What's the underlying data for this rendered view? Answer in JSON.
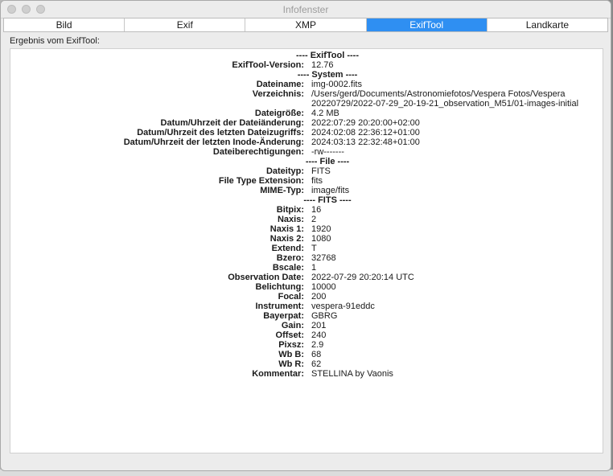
{
  "window": {
    "title": "Infofenster"
  },
  "tabs": [
    {
      "label": "Bild",
      "active": false
    },
    {
      "label": "Exif",
      "active": false
    },
    {
      "label": "XMP",
      "active": false
    },
    {
      "label": "ExifTool",
      "active": true
    },
    {
      "label": "Landkarte",
      "active": false
    }
  ],
  "result_label": "Ergebnis vom ExifTool:",
  "colors": {
    "accent": "#2f8ff2"
  },
  "rows": [
    {
      "section": "---- ExifTool ----"
    },
    {
      "key": "ExifTool-Version:",
      "value": "12.76"
    },
    {
      "section": "---- System ----"
    },
    {
      "key": "Dateiname:",
      "value": "img-0002.fits"
    },
    {
      "key": "Verzeichnis:",
      "value": "/Users/gerd/Documents/Astronomiefotos/Vespera Fotos/Vespera 20220729/2022-07-29_20-19-21_observation_M51/01-images-initial",
      "tall": true
    },
    {
      "key": "Dateigröße:",
      "value": "4.2 MB"
    },
    {
      "key": "Datum/Uhrzeit der Dateiänderung:",
      "value": "2022:07:29 20:20:00+02:00"
    },
    {
      "key": "Datum/Uhrzeit des letzten Dateizugriffs:",
      "value": "2024:02:08 22:36:12+01:00"
    },
    {
      "key": "Datum/Uhrzeit der letzten Inode-Änderung:",
      "value": "2024:03:13 22:32:48+01:00"
    },
    {
      "key": "Dateiberechtigungen:",
      "value": "-rw-------"
    },
    {
      "section": "---- File ----"
    },
    {
      "key": "Dateityp:",
      "value": "FITS"
    },
    {
      "key": "File Type Extension:",
      "value": "fits"
    },
    {
      "key": "MIME-Typ:",
      "value": "image/fits"
    },
    {
      "section": "---- FITS ----"
    },
    {
      "key": "Bitpix:",
      "value": "16"
    },
    {
      "key": "Naxis:",
      "value": "2"
    },
    {
      "key": "Naxis 1:",
      "value": "1920"
    },
    {
      "key": "Naxis 2:",
      "value": "1080"
    },
    {
      "key": "Extend:",
      "value": "T"
    },
    {
      "key": "Bzero:",
      "value": "32768"
    },
    {
      "key": "Bscale:",
      "value": "1"
    },
    {
      "key": "Observation Date:",
      "value": "2022-07-29 20:20:14 UTC"
    },
    {
      "key": "Belichtung:",
      "value": "10000"
    },
    {
      "key": "Focal:",
      "value": "200"
    },
    {
      "key": "Instrument:",
      "value": "vespera-91eddc"
    },
    {
      "key": "Bayerpat:",
      "value": "GBRG"
    },
    {
      "key": "Gain:",
      "value": "201"
    },
    {
      "key": "Offset:",
      "value": "240"
    },
    {
      "key": "Pixsz:",
      "value": "2.9"
    },
    {
      "key": "Wb B:",
      "value": "68"
    },
    {
      "key": "Wb R:",
      "value": "62"
    },
    {
      "key": "Kommentar:",
      "value": "STELLINA by Vaonis"
    }
  ]
}
